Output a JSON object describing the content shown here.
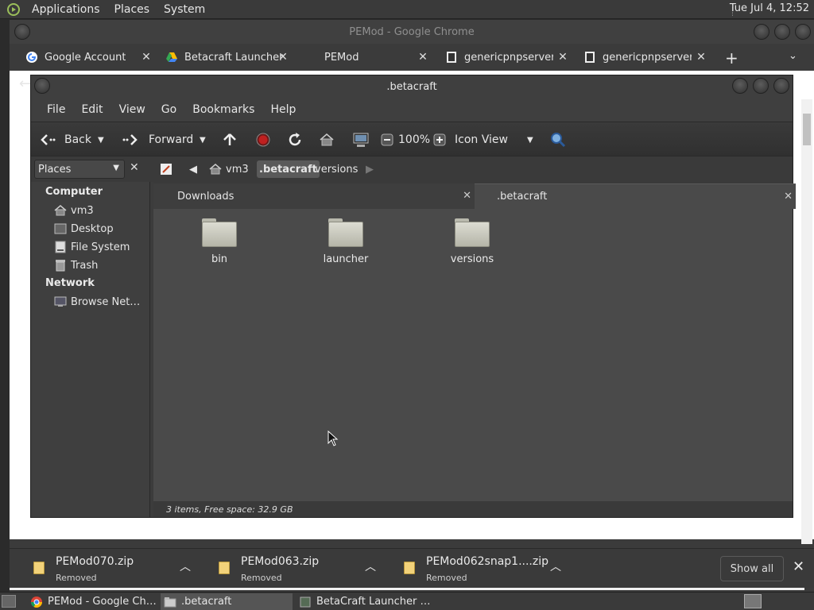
{
  "top_panel": {
    "menus": [
      "Applications",
      "Places",
      "System"
    ],
    "clock": "Tue Jul  4, 12:52"
  },
  "chrome": {
    "title": "PEMod - Google Chrome",
    "tabs": [
      {
        "label": "Google Account",
        "icon": "google-icon"
      },
      {
        "label": "Betacraft Launcher",
        "icon": "drive-icon"
      },
      {
        "label": "PEMod",
        "icon": "none"
      },
      {
        "label": "genericpnpserver.d",
        "icon": "page-icon"
      },
      {
        "label": "genericpnpserver.d",
        "icon": "page-icon"
      }
    ],
    "new_tab": "+",
    "downloads": [
      {
        "name": "PEMod070.zip",
        "status": "Removed"
      },
      {
        "name": "PEMod063.zip",
        "status": "Removed"
      },
      {
        "name": "PEMod062snap1....zip",
        "status": "Removed"
      }
    ],
    "show_all": "Show all"
  },
  "nautilus": {
    "title": ".betacraft",
    "menu": [
      "File",
      "Edit",
      "View",
      "Go",
      "Bookmarks",
      "Help"
    ],
    "toolbar": {
      "back": "Back",
      "forward": "Forward",
      "zoom": "100%",
      "view_mode": "Icon View"
    },
    "places_label": "Places",
    "path": [
      "vm3",
      ".betacraft",
      "versions"
    ],
    "active_crumb": ".betacraft",
    "sidebar": {
      "computer_header": "Computer",
      "computer_items": [
        {
          "label": "vm3",
          "icon": "home-icon"
        },
        {
          "label": "Desktop",
          "icon": "desktop-icon"
        },
        {
          "label": "File System",
          "icon": "drive-icon"
        },
        {
          "label": "Trash",
          "icon": "trash-icon"
        }
      ],
      "network_header": "Network",
      "network_items": [
        {
          "label": "Browse Net…",
          "icon": "network-icon"
        }
      ]
    },
    "tabs": [
      {
        "label": "Downloads"
      },
      {
        "label": ".betacraft"
      }
    ],
    "files": [
      {
        "name": "bin"
      },
      {
        "name": "launcher"
      },
      {
        "name": "versions"
      }
    ],
    "status": "3 items, Free space: 32.9 GB"
  },
  "taskbar": {
    "tasks": [
      {
        "label": "PEMod - Google Ch…",
        "icon": "chrome-icon"
      },
      {
        "label": ".betacraft",
        "icon": "folder-icon"
      },
      {
        "label": "BetaCraft Launcher …",
        "icon": "java-icon"
      }
    ]
  },
  "colors": {
    "panel": "#3a3a3a",
    "window_bg": "#3c3c3c",
    "content_bg": "#4a4a4a",
    "folder": "#d2d2c6"
  }
}
